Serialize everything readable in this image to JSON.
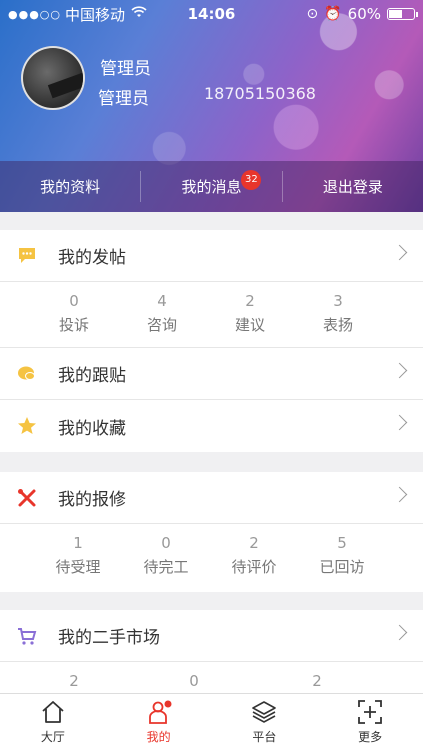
{
  "status_bar": {
    "signal": "●●●○○",
    "carrier": "中国移动",
    "time": "14:06",
    "battery": "60%",
    "battery_level": 0.6
  },
  "profile": {
    "name_line1": "管理员",
    "name_line2": "管理员",
    "phone": "18705150368"
  },
  "header_actions": [
    {
      "label": "我的资料"
    },
    {
      "label": "我的消息",
      "badge": "32"
    },
    {
      "label": "退出登录"
    }
  ],
  "posts": {
    "label": "我的发帖",
    "stats": [
      {
        "value": "0",
        "label": "投诉"
      },
      {
        "value": "4",
        "label": "咨询"
      },
      {
        "value": "2",
        "label": "建议"
      },
      {
        "value": "3",
        "label": "表扬"
      }
    ]
  },
  "replies": {
    "label": "我的跟贴"
  },
  "favorites": {
    "label": "我的收藏"
  },
  "repairs": {
    "label": "我的报修",
    "stats": [
      {
        "value": "1",
        "label": "待受理"
      },
      {
        "value": "0",
        "label": "待完工"
      },
      {
        "value": "2",
        "label": "待评价"
      },
      {
        "value": "5",
        "label": "已回访"
      }
    ]
  },
  "market": {
    "label": "我的二手市场",
    "stats": [
      {
        "value": "2"
      },
      {
        "value": "0"
      },
      {
        "value": "2"
      }
    ]
  },
  "tabs": [
    {
      "label": "大厅",
      "icon": "home-icon"
    },
    {
      "label": "我的",
      "icon": "user-icon"
    },
    {
      "label": "平台",
      "icon": "layers-icon"
    },
    {
      "label": "更多",
      "icon": "plus-square-icon"
    }
  ],
  "colors": {
    "accent": "#e8352b",
    "icon_yellow": "#f5c342",
    "icon_red": "#e8352b",
    "icon_purple": "#8a6fd6"
  }
}
